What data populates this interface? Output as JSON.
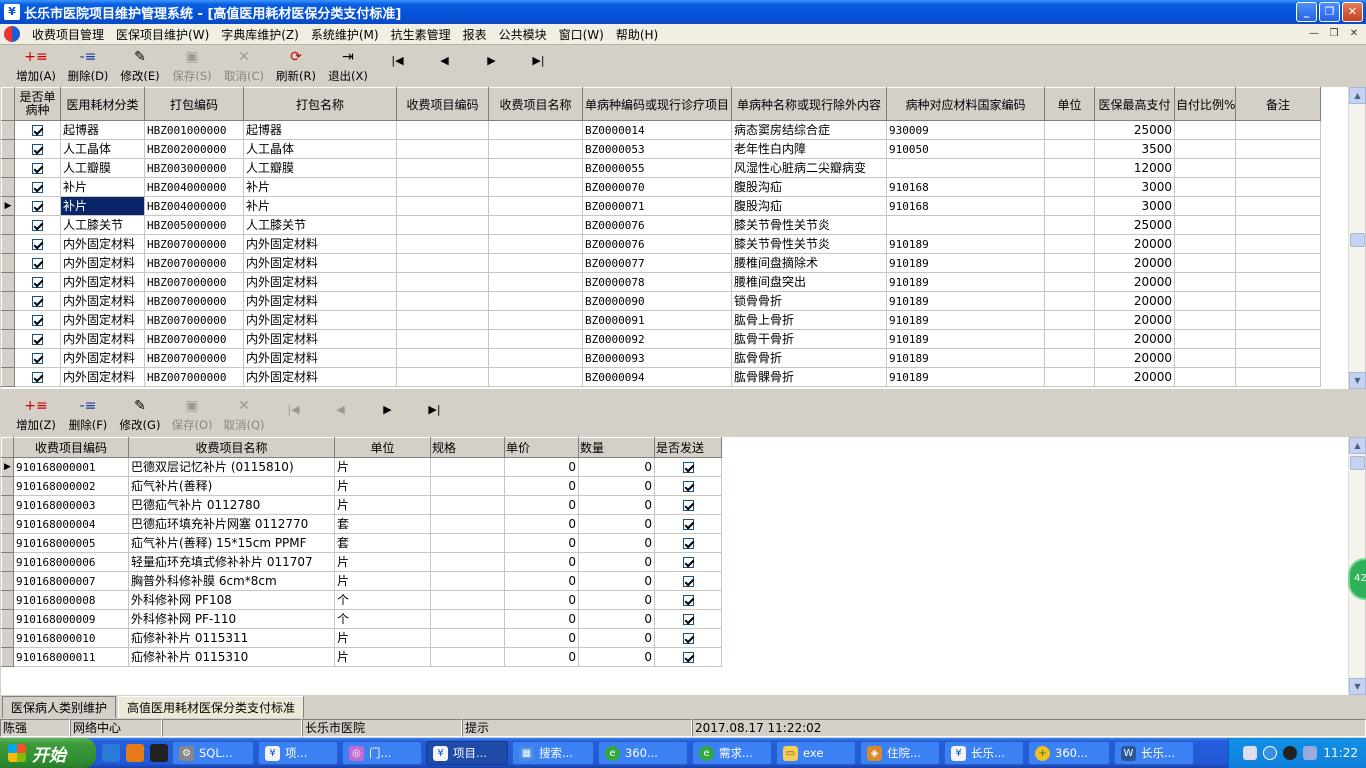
{
  "window": {
    "title": "长乐市医院项目维护管理系统 - [高值医用耗材医保分类支付标准]"
  },
  "menu": [
    "收费项目管理",
    "医保项目维护(W)",
    "字典库维护(Z)",
    "系统维护(M)",
    "抗生素管理",
    "报表",
    "公共模块",
    "窗口(W)",
    "帮助(H)"
  ],
  "toolbar_top": {
    "add": "增加(A)",
    "delete": "删除(D)",
    "edit": "修改(E)",
    "save": "保存(S)",
    "cancel": "取消(C)",
    "refresh": "刷新(R)",
    "exit": "退出(X)"
  },
  "toolbar_bottom": {
    "add": "增加(Z)",
    "delete": "删除(F)",
    "edit": "修改(G)",
    "save": "保存(O)",
    "cancel": "取消(Q)"
  },
  "top_grid": {
    "headers": [
      "是否单病种",
      "医用耗材分类",
      "打包编码",
      "打包名称",
      "收费项目编码",
      "收费项目名称",
      "单病种编码或现行诊疗项目",
      "单病种名称或现行除外内容",
      "病种对应材料国家编码",
      "单位",
      "医保最高支付",
      "自付比例%",
      "备注"
    ],
    "rows": [
      [
        "",
        "起博器",
        "HBZ001000000",
        "起博器",
        "",
        "",
        "BZ0000014",
        "病态窦房结综合症",
        "930009",
        "",
        "25000",
        "",
        ""
      ],
      [
        "",
        "人工晶体",
        "HBZ002000000",
        "人工晶体",
        "",
        "",
        "BZ0000053",
        "老年性白内障",
        "910050",
        "",
        "3500",
        "",
        ""
      ],
      [
        "",
        "人工瓣膜",
        "HBZ003000000",
        "人工瓣膜",
        "",
        "",
        "BZ0000055",
        "风湿性心脏病二尖瓣病变",
        "",
        "",
        "12000",
        "",
        ""
      ],
      [
        "",
        "补片",
        "HBZ004000000",
        "补片",
        "",
        "",
        "BZ0000070",
        "腹股沟疝",
        "910168",
        "",
        "3000",
        "",
        ""
      ],
      [
        "",
        "补片",
        "HBZ004000000",
        "补片",
        "",
        "",
        "BZ0000071",
        "腹股沟疝",
        "910168",
        "",
        "3000",
        "",
        ""
      ],
      [
        "",
        "人工膝关节",
        "HBZ005000000",
        "人工膝关节",
        "",
        "",
        "BZ0000076",
        "膝关节骨性关节炎",
        "",
        "",
        "25000",
        "",
        ""
      ],
      [
        "",
        "内外固定材料",
        "HBZ007000000",
        "内外固定材料",
        "",
        "",
        "BZ0000076",
        "膝关节骨性关节炎",
        "910189",
        "",
        "20000",
        "",
        ""
      ],
      [
        "",
        "内外固定材料",
        "HBZ007000000",
        "内外固定材料",
        "",
        "",
        "BZ0000077",
        "腰椎间盘摘除术",
        "910189",
        "",
        "20000",
        "",
        ""
      ],
      [
        "",
        "内外固定材料",
        "HBZ007000000",
        "内外固定材料",
        "",
        "",
        "BZ0000078",
        "腰椎间盘突出",
        "910189",
        "",
        "20000",
        "",
        ""
      ],
      [
        "",
        "内外固定材料",
        "HBZ007000000",
        "内外固定材料",
        "",
        "",
        "BZ0000090",
        "锁骨骨折",
        "910189",
        "",
        "20000",
        "",
        ""
      ],
      [
        "",
        "内外固定材料",
        "HBZ007000000",
        "内外固定材料",
        "",
        "",
        "BZ0000091",
        "肱骨上骨折",
        "910189",
        "",
        "20000",
        "",
        ""
      ],
      [
        "",
        "内外固定材料",
        "HBZ007000000",
        "内外固定材料",
        "",
        "",
        "BZ0000092",
        "肱骨干骨折",
        "910189",
        "",
        "20000",
        "",
        ""
      ],
      [
        "",
        "内外固定材料",
        "HBZ007000000",
        "内外固定材料",
        "",
        "",
        "BZ0000093",
        "肱骨骨折",
        "910189",
        "",
        "20000",
        "",
        ""
      ],
      [
        "",
        "内外固定材料",
        "HBZ007000000",
        "内外固定材料",
        "",
        "",
        "BZ0000094",
        "肱骨髁骨折",
        "910189",
        "",
        "20000",
        "",
        ""
      ]
    ]
  },
  "bottom_grid": {
    "headers": [
      "收费项目编码",
      "收费项目名称",
      "单位",
      "规格",
      "单价",
      "数量",
      "是否发送"
    ],
    "rows": [
      [
        "910168000001",
        "巴德双层记忆补片 (0115810)",
        "片",
        "",
        "0",
        "0"
      ],
      [
        "910168000002",
        "疝气补片(善释)",
        "片",
        "",
        "0",
        "0"
      ],
      [
        "910168000003",
        "巴德疝气补片 0112780",
        "片",
        "",
        "0",
        "0"
      ],
      [
        "910168000004",
        "巴德疝环填充补片网塞 0112770",
        "套",
        "",
        "0",
        "0"
      ],
      [
        "910168000005",
        "疝气补片(善释) 15*15cm PPMF",
        "套",
        "",
        "0",
        "0"
      ],
      [
        "910168000006",
        "轻量疝环充填式修补补片 011707",
        "片",
        "",
        "0",
        "0"
      ],
      [
        "910168000007",
        "胸普外科修补膜 6cm*8cm",
        "片",
        "",
        "0",
        "0"
      ],
      [
        "910168000008",
        "外科修补网 PF108",
        "个",
        "",
        "0",
        "0"
      ],
      [
        "910168000009",
        "外科修补网 PF-110",
        "个",
        "",
        "0",
        "0"
      ],
      [
        "910168000010",
        "疝修补补片 0115311",
        "片",
        "",
        "0",
        "0"
      ],
      [
        "910168000011",
        "疝修补补片 0115310",
        "片",
        "",
        "0",
        "0"
      ]
    ]
  },
  "bottom_tabs": [
    "医保病人类别维护",
    "高值医用耗材医保分类支付标准"
  ],
  "status": [
    "陈强",
    "网络中心",
    "",
    "长乐市医院",
    "提示",
    "2017.08.17  11:22:02"
  ],
  "taskbar": {
    "start": "开始",
    "tasks": [
      "SQL...",
      "项...",
      "门...",
      "项目...",
      "搜索...",
      "360...",
      "需求...",
      "exe",
      "住院...",
      "长乐...",
      "360...",
      "长乐..."
    ],
    "clock": "11:22"
  },
  "float_badge": "42",
  "colors": {
    "selection": "#0a246a",
    "titlebar": "#0451d9",
    "taskbar": "#245edb",
    "start": "#3c9a3c"
  }
}
